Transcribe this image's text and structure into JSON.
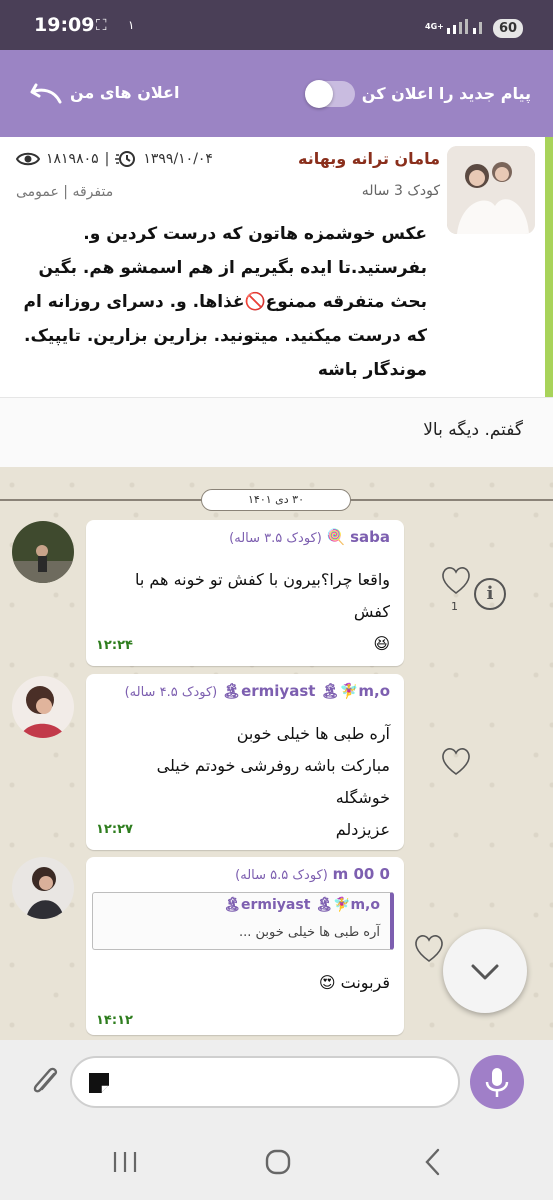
{
  "status_bar": {
    "time": "19:09",
    "extra_indicator": "١",
    "network": "4G+",
    "battery": "60"
  },
  "header": {
    "my_ads_label": "اعلان های من",
    "announce_toggle_label": "پیام جدید را اعلان کن",
    "toggle_on": false
  },
  "pinned_post": {
    "author": "مامان ترانه وبهانه",
    "child_age": "کودک 3 ساله",
    "date": "۱۳۹۹/۱۰/۰۴",
    "views": "۱۸۱۹۸۰۵",
    "separator": "|",
    "category": "متفرقه | عمومی",
    "body_lines": [
      "عکس خوشمزه هاتون که درست کردین و.",
      "بفرستید.تا ایده بگیریم از هم اسمشو هم. بگین",
      "بحث متفرقه ممنوع🚫غذاها. و. دسرای روزانه ام",
      "که درست میکنید. میتونید. بزارین بزارین. تایپیک.",
      "موندگار باشه"
    ],
    "reply_text": "گفتم. دیگه بالا"
  },
  "chat": {
    "date_chip": "۳۰ دی ۱۴۰۱",
    "messages": [
      {
        "name": "saba",
        "name_emoji": "🍭",
        "kid_age": "(کودک ۳.۵ ساله)",
        "lines": [
          "واقعا چرا؟بیرون با کفش تو خونه هم با کفش",
          "😆"
        ],
        "time": "۱۲:۲۴",
        "likes": "1"
      },
      {
        "name": "ermiyast 🏝🧚‍♀️m,o🏝",
        "name_emoji": "",
        "kid_age": "(کودک ۴.۵ ساله)",
        "lines": [
          "آره طبی ها خیلی خوبن",
          "مبارکت باشه روفرشی خودتم خیلی خوشگله",
          "عزیزدلم"
        ],
        "time": "۱۲:۲۷",
        "likes": ""
      },
      {
        "name": "m 00 0",
        "name_emoji": "",
        "kid_age": "(کودک ۵.۵ ساله)",
        "quote_name": "ermiyast 🏝🧚‍♀️m,o🏝",
        "quote_text": "آره طبی ها خیلی خوبن ...",
        "lines": [
          "قربونت 😍"
        ],
        "time": "۱۴:۱۲",
        "likes": ""
      }
    ]
  },
  "composer": {
    "placeholder": ""
  },
  "icons": {
    "back": "back-arrow-icon",
    "views": "eye-icon",
    "date": "calendar-clock-icon",
    "like": "heart-icon",
    "info": "info-icon",
    "attach": "paperclip-icon",
    "sticker": "sticker-icon",
    "mic": "microphone-icon",
    "scroll": "chevron-down-icon"
  },
  "colors": {
    "header": "#9b84c4",
    "accent_green": "#a8d35a",
    "author": "#8a2f1c",
    "username": "#7d5fb0",
    "time": "#2e7d1e"
  }
}
